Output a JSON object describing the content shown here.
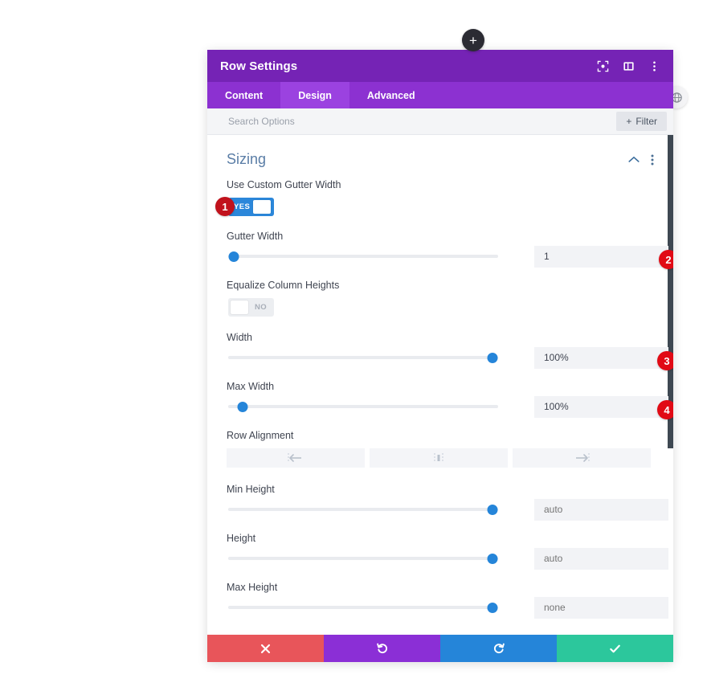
{
  "window": {
    "title": "Row Settings",
    "header_icons": [
      "focus-icon",
      "panel-layout-icon",
      "more-vertical-icon"
    ]
  },
  "fab": {
    "label": "+",
    "name": "add-module-button"
  },
  "side_button": {
    "name": "globe-close-button"
  },
  "tabs": [
    {
      "label": "Content",
      "active": false
    },
    {
      "label": "Design",
      "active": true
    },
    {
      "label": "Advanced",
      "active": false
    }
  ],
  "search": {
    "placeholder": "Search Options",
    "value": "",
    "filter_label": "Filter",
    "filter_plus": "+"
  },
  "section": {
    "title": "Sizing",
    "collapse_icon": "chevron-up-icon",
    "menu_icon": "more-vertical-icon"
  },
  "fields": {
    "use_custom_gutter": {
      "label": "Use Custom Gutter Width",
      "toggle_state": "YES",
      "badge": "1"
    },
    "gutter_width": {
      "label": "Gutter Width",
      "value": "1",
      "is_placeholder": false,
      "slider_percent": 2,
      "badge": "2"
    },
    "equalize_column_heights": {
      "label": "Equalize Column Heights",
      "toggle_state": "NO"
    },
    "width": {
      "label": "Width",
      "value": "100%",
      "is_placeholder": false,
      "slider_percent": 98,
      "badge": "3"
    },
    "max_width": {
      "label": "Max Width",
      "value": "100%",
      "is_placeholder": false,
      "slider_percent": 5,
      "badge": "4"
    },
    "row_alignment": {
      "label": "Row Alignment",
      "options": [
        "align-left-icon",
        "align-center-icon",
        "align-right-icon"
      ]
    },
    "min_height": {
      "label": "Min Height",
      "value": "auto",
      "is_placeholder": true,
      "slider_percent": 98
    },
    "height": {
      "label": "Height",
      "value": "auto",
      "is_placeholder": true,
      "slider_percent": 98
    },
    "max_height": {
      "label": "Max Height",
      "value": "none",
      "is_placeholder": true,
      "slider_percent": 98
    }
  },
  "footer": {
    "buttons": [
      {
        "name": "cancel-button",
        "icon": "close-icon",
        "color": "#e8555a"
      },
      {
        "name": "undo-button",
        "icon": "undo-icon",
        "color": "#8b2fd6"
      },
      {
        "name": "redo-button",
        "icon": "redo-icon",
        "color": "#2585d9"
      },
      {
        "name": "save-button",
        "icon": "check-icon",
        "color": "#2cc79c"
      }
    ]
  },
  "colors": {
    "header_purple": "#7523b5",
    "tab_bar_purple": "#8c31d1",
    "tab_active_purple": "#9b42e0",
    "accent_blue": "#2585d9",
    "badge_red": "#e10a15",
    "section_title_blue": "#5a7da6"
  }
}
